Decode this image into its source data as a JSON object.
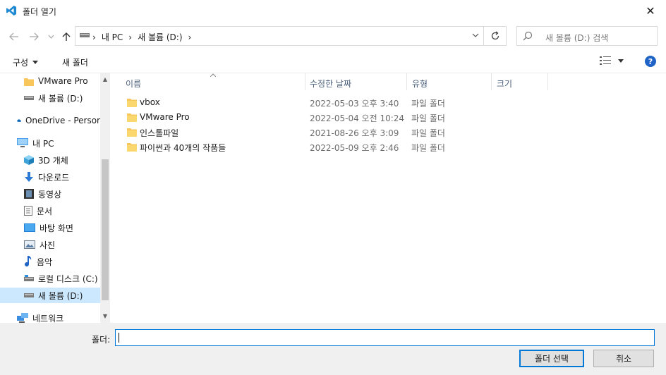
{
  "window": {
    "title": "폴더 열기",
    "close_glyph": "✕"
  },
  "address": {
    "crumbs": [
      "내 PC",
      "새 볼륨 (D:)"
    ],
    "search_placeholder": "새 볼륨 (D:) 검색"
  },
  "toolbar": {
    "organize_label": "구성",
    "new_folder_label": "새 폴더",
    "help_label": "?"
  },
  "sidebar": {
    "items": [
      {
        "label": "VMware Pro",
        "icon": "folder-icon"
      },
      {
        "label": "새 볼륨 (D:)",
        "icon": "drive-icon"
      },
      {
        "label": "OneDrive - Persor",
        "icon": "cloud-icon"
      },
      {
        "label": "내 PC",
        "icon": "pc-icon"
      },
      {
        "label": "3D 개체",
        "icon": "cube-icon"
      },
      {
        "label": "다운로드",
        "icon": "download-icon"
      },
      {
        "label": "동영상",
        "icon": "video-icon"
      },
      {
        "label": "문서",
        "icon": "document-icon"
      },
      {
        "label": "바탕 화면",
        "icon": "desktop-icon"
      },
      {
        "label": "사진",
        "icon": "picture-icon"
      },
      {
        "label": "음악",
        "icon": "music-icon"
      },
      {
        "label": "로컬 디스크 (C:)",
        "icon": "drive-icon"
      },
      {
        "label": "새 볼륨 (D:)",
        "icon": "drive-icon"
      },
      {
        "label": "네트워크",
        "icon": "network-icon"
      }
    ]
  },
  "columns": {
    "name": "이름",
    "modified": "수정한 날짜",
    "type": "유형",
    "size": "크기"
  },
  "files": [
    {
      "name": "vbox",
      "modified": "2022-05-03 오후 3:40",
      "type": "파일 폴더"
    },
    {
      "name": "VMware Pro",
      "modified": "2022-05-04 오전 10:24",
      "type": "파일 폴더"
    },
    {
      "name": "인스톨파일",
      "modified": "2021-08-26 오후 3:09",
      "type": "파일 폴더"
    },
    {
      "name": "파이썬과 40개의 작품들",
      "modified": "2022-05-09 오후 2:46",
      "type": "파일 폴더"
    }
  ],
  "footer": {
    "folder_label": "폴더:",
    "folder_value": "",
    "select_label": "폴더 선택",
    "cancel_label": "취소"
  },
  "colors": {
    "accent": "#0078d7",
    "folder": "#f7c75c",
    "selection": "#cce8ff"
  }
}
